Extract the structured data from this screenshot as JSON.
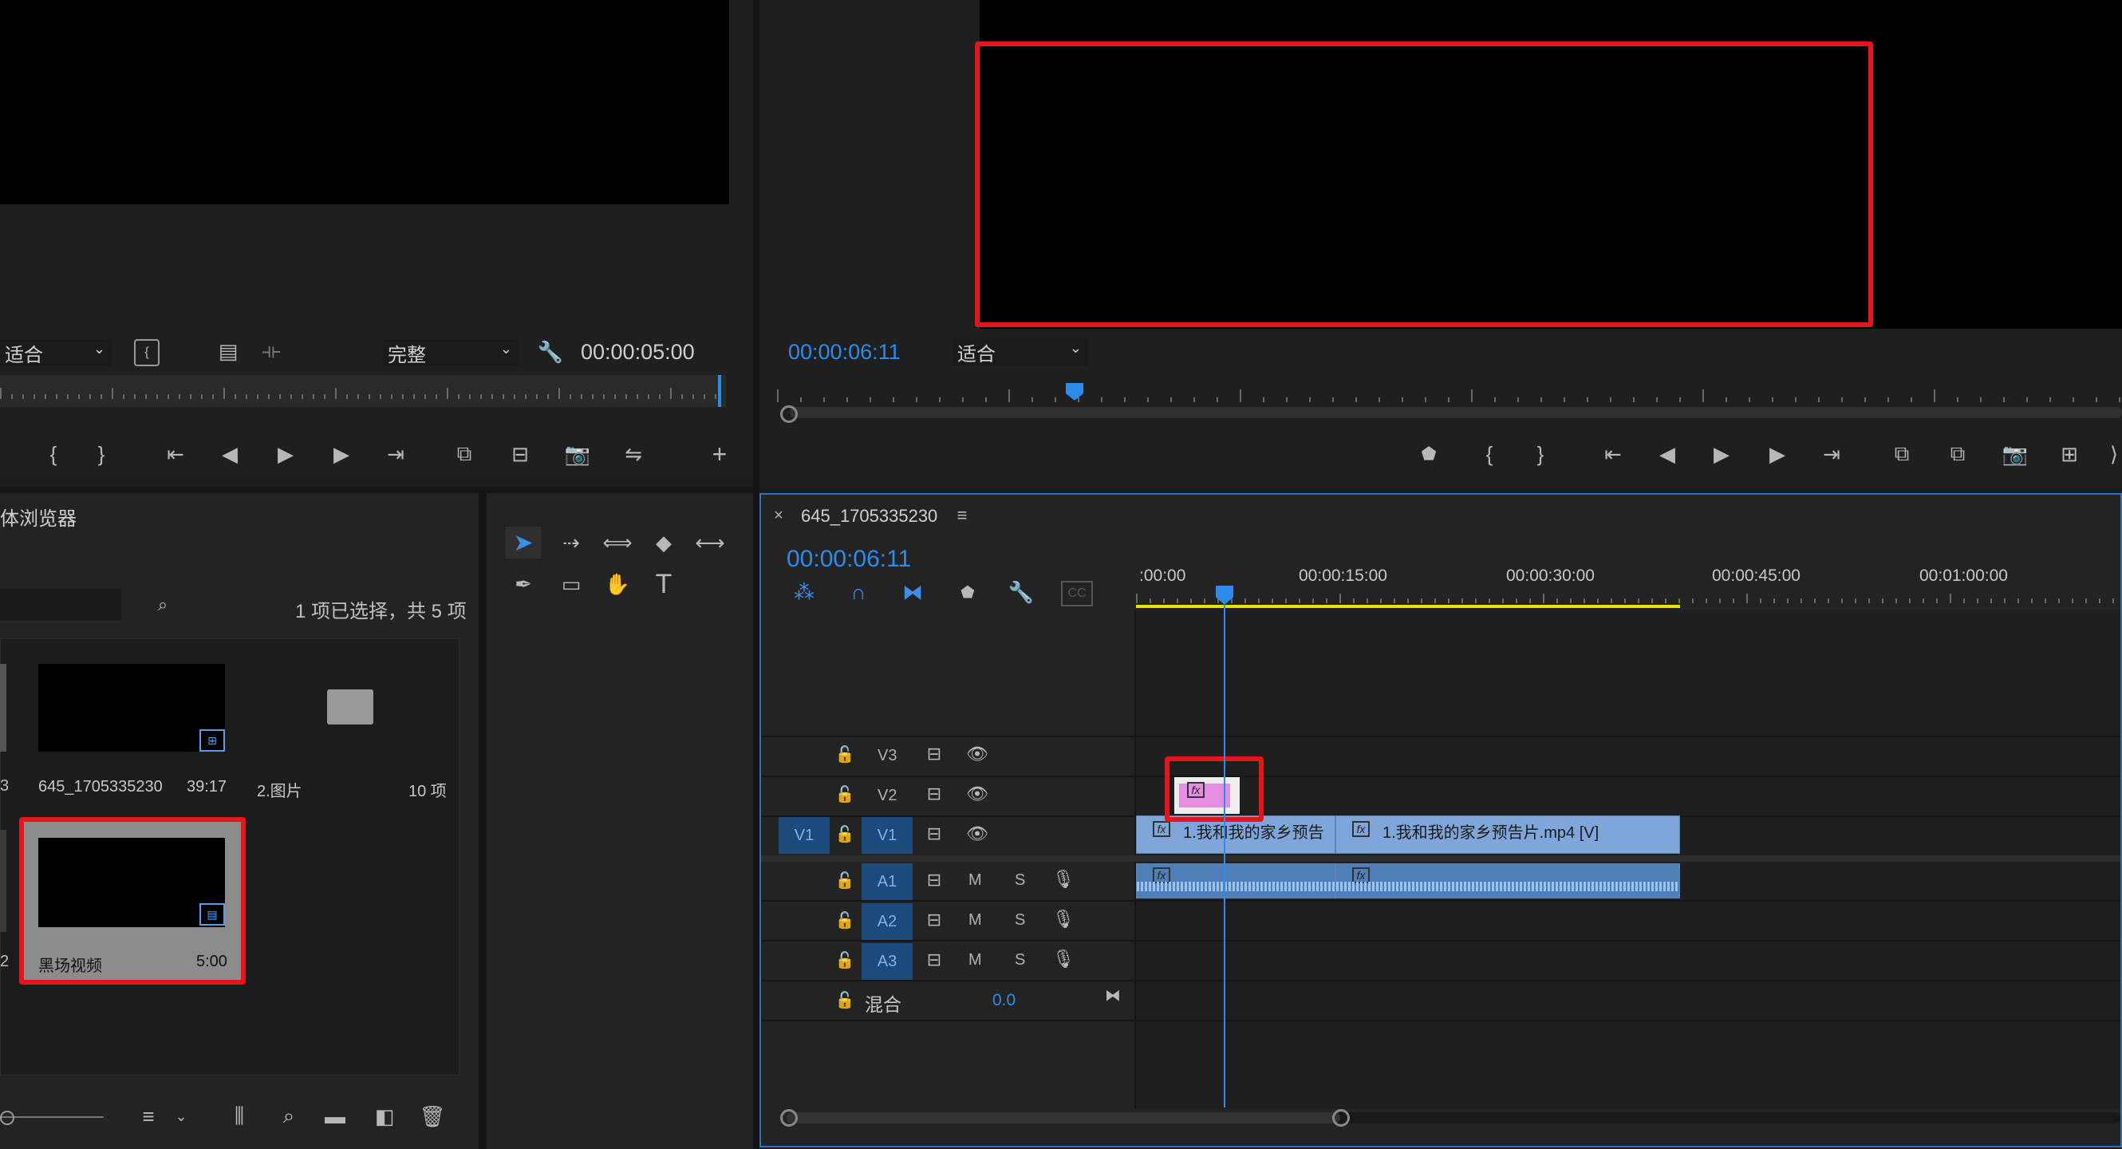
{
  "source_monitor": {
    "zoom_select": "适合",
    "quality_select": "完整",
    "timecode": "00:00:05:00"
  },
  "program_monitor": {
    "timecode": "00:00:06:11",
    "zoom_select": "适合"
  },
  "project_panel": {
    "title": "体浏览器",
    "selection_info": "1 项已选择，共 5 项",
    "items": [
      {
        "name": "645_1705335230",
        "duration": "39:17"
      },
      {
        "name": "2.图片",
        "count": "10 项"
      },
      {
        "name": "黑场视频",
        "duration": "5:00"
      }
    ],
    "left_partial": [
      "3",
      "2"
    ]
  },
  "timeline": {
    "sequence_name": "645_1705335230",
    "timecode": "00:00:06:11",
    "ruler_labels": [
      ":00:00",
      "00:00:15:00",
      "00:00:30:00",
      "00:00:45:00",
      "00:01:00:00"
    ],
    "tracks": {
      "v3": "V3",
      "v2": "V2",
      "v1_source": "V1",
      "v1": "V1",
      "a1": "A1",
      "a2": "A2",
      "a3": "A3"
    },
    "mute": "M",
    "solo": "S",
    "mix_label": "混合",
    "mix_value": "0.0",
    "clips": {
      "v1_clip1": "1.我和我的家乡预告",
      "v1_clip2": "1.我和我的家乡预告片.mp4 [V]"
    }
  },
  "colors": {
    "accent_blue": "#2d8ceb",
    "highlight_red": "#e8141c",
    "clip_blue": "#7ea6d8",
    "work_area_yellow": "#e8e000",
    "pink_clip": "#e38ee3"
  },
  "icons": [
    "selection-tool-icon",
    "track-select-icon",
    "ripple-edit-icon",
    "razor-icon",
    "slip-icon",
    "pen-icon",
    "rectangle-icon",
    "hand-icon",
    "type-icon",
    "wrench-icon",
    "camera-icon",
    "play-icon",
    "eye-icon",
    "lock-icon",
    "mic-icon",
    "search-icon",
    "folder-icon",
    "trash-icon"
  ]
}
